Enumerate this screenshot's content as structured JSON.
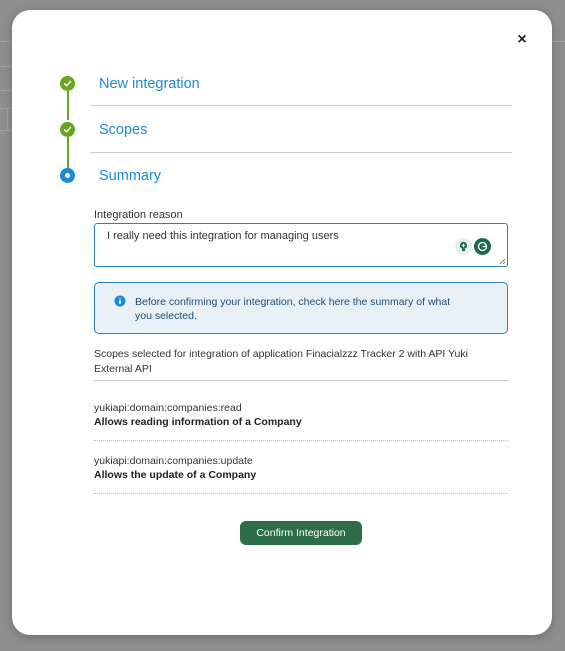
{
  "modal": {
    "close_label": "×"
  },
  "stepper": {
    "steps": [
      {
        "label": "New integration",
        "state": "done"
      },
      {
        "label": "Scopes",
        "state": "done"
      },
      {
        "label": "Summary",
        "state": "active"
      }
    ]
  },
  "form": {
    "reason_label": "Integration reason",
    "reason_value": "I really need this integration for managing users"
  },
  "info": {
    "text": "Before confirming your integration, check here the summary of what you selected."
  },
  "summary": {
    "heading": "Scopes selected for integration of application Finacialzzz Tracker 2 with API Yuki External API",
    "scopes": [
      {
        "name": "yukiapi:domain:companies:read",
        "description": "Allows reading information of a Company"
      },
      {
        "name": "yukiapi:domain:companies:update",
        "description": "Allows the update of a Company"
      }
    ]
  },
  "actions": {
    "confirm_label": "Confirm Integration"
  },
  "colors": {
    "step_done": "#6aa522",
    "step_active": "#1a8bd6",
    "info_bg": "#e8f1f8",
    "confirm_bg": "#2d6e48"
  }
}
